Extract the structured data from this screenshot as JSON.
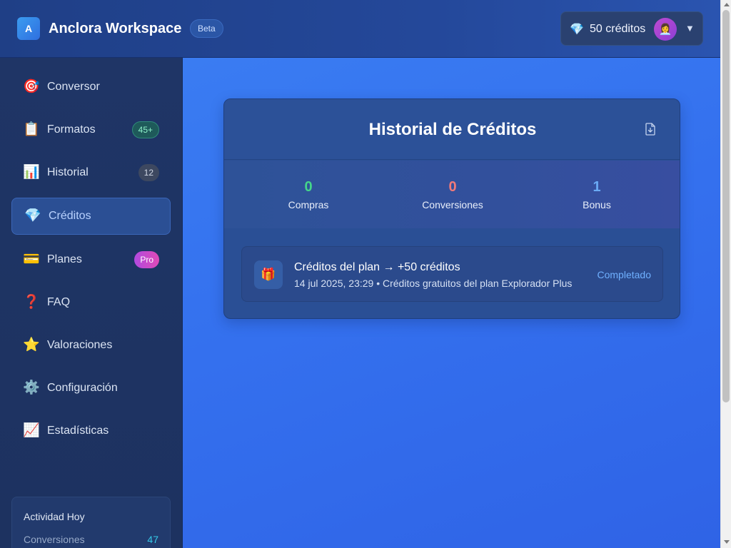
{
  "header": {
    "logo_letter": "A",
    "app_title": "Anclora Workspace",
    "beta_label": "Beta",
    "credits_label": "50 créditos",
    "gem_icon": "💎",
    "avatar_icon": "👩‍💼",
    "caret_icon": "▼"
  },
  "sidebar": {
    "items": [
      {
        "icon": "🎯",
        "label": "Conversor"
      },
      {
        "icon": "📋",
        "label": "Formatos",
        "badge": "45+"
      },
      {
        "icon": "📊",
        "label": "Historial",
        "badge": "12"
      },
      {
        "icon": "💎",
        "label": "Créditos",
        "active": true
      },
      {
        "icon": "💳",
        "label": "Planes",
        "badge": "Pro"
      },
      {
        "icon": "❓",
        "label": "FAQ"
      },
      {
        "icon": "⭐",
        "label": "Valoraciones"
      },
      {
        "icon": "⚙️",
        "label": "Configuración"
      },
      {
        "icon": "📈",
        "label": "Estadísticas"
      }
    ],
    "activity": {
      "title": "Actividad Hoy",
      "conversions_label": "Conversiones",
      "conversions_value": "47"
    }
  },
  "main": {
    "card_title": "Historial de Créditos",
    "stats": [
      {
        "value": "0",
        "label": "Compras"
      },
      {
        "value": "0",
        "label": "Conversiones"
      },
      {
        "value": "1",
        "label": "Bonus"
      }
    ],
    "transactions": [
      {
        "icon": "🎁",
        "title": "Créditos del plan → +50 créditos",
        "subtitle": "14 jul 2025, 23:29 • Créditos gratuitos del plan Explorador Plus",
        "status": "Completado"
      }
    ]
  },
  "colors": {
    "accent": "#3b82f6",
    "green": "#45d68a",
    "red": "#f07a7a",
    "blue": "#6aaaf5"
  }
}
